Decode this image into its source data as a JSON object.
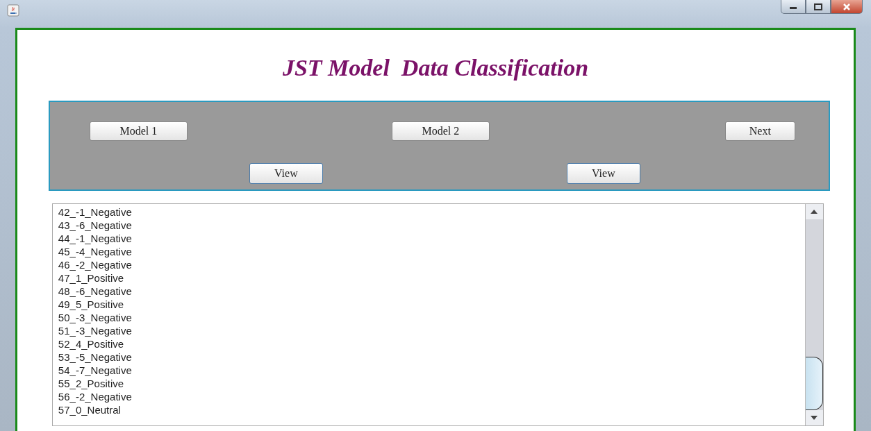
{
  "heading": "JST Model  Data Classification",
  "toolbar": {
    "row_1": [
      {
        "label": "Model 1"
      },
      {
        "label": "Model 2"
      },
      {
        "label": "Next"
      }
    ],
    "row_2": [
      {
        "label": "View"
      },
      {
        "label": "View"
      }
    ]
  },
  "results": [
    "42_-1_Negative",
    "43_-6_Negative",
    "44_-1_Negative",
    "45_-4_Negative",
    "46_-2_Negative",
    "47_1_Positive",
    "48_-6_Negative",
    "49_5_Positive",
    "50_-3_Negative",
    "51_-3_Negative",
    "52_4_Positive",
    "53_-5_Negative",
    "54_-7_Negative",
    "55_2_Positive",
    "56_-2_Negative",
    "57_0_Neutral"
  ]
}
